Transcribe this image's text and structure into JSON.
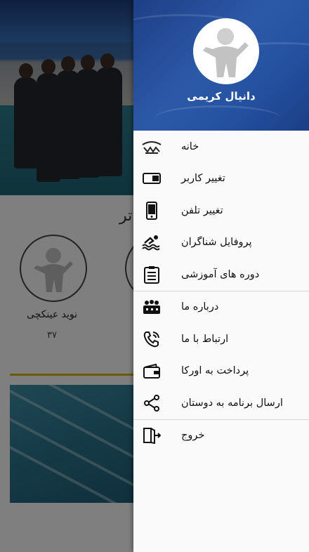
{
  "background": {
    "section_title": "تر",
    "contact": {
      "name": "نوید عینکچی",
      "count": "۳۷"
    }
  },
  "drawer": {
    "user_name": "دانیال کریمی",
    "groups": [
      [
        {
          "label": "خانه",
          "icon": "home-logo-icon"
        },
        {
          "label": "تغییر کاربر",
          "icon": "card-icon"
        },
        {
          "label": "تغییر تلفن",
          "icon": "phone-icon"
        },
        {
          "label": "پروفایل شناگران",
          "icon": "swimmer-icon"
        },
        {
          "label": "دوره های آموزشی",
          "icon": "clipboard-icon"
        }
      ],
      [
        {
          "label": "درباره ما",
          "icon": "team-icon"
        },
        {
          "label": "ارتباط با ما",
          "icon": "call-icon"
        },
        {
          "label": "پرداخت به اورکا",
          "icon": "wallet-icon"
        },
        {
          "label": "ارسال برنامه به دوستان",
          "icon": "share-icon"
        }
      ],
      [
        {
          "label": "خروج",
          "icon": "exit-icon"
        }
      ]
    ]
  }
}
